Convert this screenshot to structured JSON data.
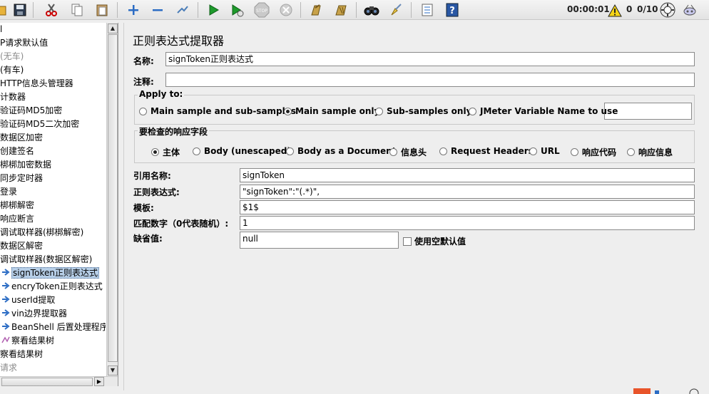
{
  "toolbar": {
    "icons": [
      "open-icon",
      "save-icon",
      "cut-icon",
      "copy-icon",
      "paste-icon",
      "expand-icon",
      "collapse-icon",
      "toggle-icon",
      "start-icon",
      "start-no-pause-icon",
      "stop-icon",
      "shutdown-icon",
      "clear-icon",
      "clear-all-icon",
      "search-icon",
      "reset-search-icon",
      "function-helper-icon",
      "help-icon"
    ],
    "timer": "00:00:01",
    "warning_count": "0",
    "threads": "0/10"
  },
  "tree": {
    "items": [
      {
        "label": "l",
        "grey": false
      },
      {
        "label": "P请求默认值",
        "grey": false
      },
      {
        "label": "(无车)",
        "grey": true
      },
      {
        "label": "(有车)",
        "grey": false
      },
      {
        "label": "HTTP信息头管理器",
        "grey": false
      },
      {
        "label": "计数器",
        "grey": false
      },
      {
        "label": "验证码MD5加密",
        "grey": false
      },
      {
        "label": "验证码MD5二次加密",
        "grey": false
      },
      {
        "label": "数据区加密",
        "grey": false
      },
      {
        "label": "创建签名",
        "grey": false
      },
      {
        "label": "梆梆加密数据",
        "grey": false
      },
      {
        "label": "同步定时器",
        "grey": false
      },
      {
        "label": "登录",
        "grey": false
      },
      {
        "label": "梆梆解密",
        "grey": false
      },
      {
        "label": "响应断言",
        "grey": false
      },
      {
        "label": "调试取样器(梆梆解密)",
        "grey": false
      },
      {
        "label": "数据区解密",
        "grey": false
      },
      {
        "label": "调试取样器(数据区解密)",
        "grey": false
      },
      {
        "label": "signToken正则表达式",
        "grey": false
      },
      {
        "label": "encryToken正则表达式",
        "grey": false
      },
      {
        "label": "userId提取",
        "grey": false
      },
      {
        "label": "vin边界提取器",
        "grey": false
      },
      {
        "label": "BeanShell 后置处理程序",
        "grey": false
      },
      {
        "label": "察看结果树",
        "grey": false
      },
      {
        "label": "察看结果树",
        "grey": false
      },
      {
        "label": "请求",
        "grey": true
      }
    ]
  },
  "panel": {
    "title": "正则表达式提取器",
    "name_label": "名称:",
    "name_value": "signToken正则表达式",
    "comment_label": "注释:",
    "comment_value": "",
    "apply_to": {
      "title": "Apply to:",
      "options": [
        "Main sample and sub-samples",
        "Main sample only",
        "Sub-samples only",
        "JMeter Variable Name to use"
      ],
      "selected": "Main sample only",
      "variable_value": ""
    },
    "response_field": {
      "title": "要检查的响应字段",
      "options": [
        "主体",
        "Body (unescaped)",
        "Body as a Document",
        "信息头",
        "Request Headers",
        "URL",
        "响应代码",
        "响应信息"
      ],
      "selected": "主体"
    },
    "ref_name_label": "引用名称:",
    "ref_name_value": "signToken",
    "regex_label": "正则表达式:",
    "regex_value": "\"signToken\":\"(.*)\",",
    "template_label": "模板:",
    "template_value": "$1$",
    "match_label": "匹配数字（0代表随机）:",
    "match_value": "1",
    "default_label": "缺省值:",
    "default_value": "null",
    "use_empty_label": "使用空默认值"
  }
}
